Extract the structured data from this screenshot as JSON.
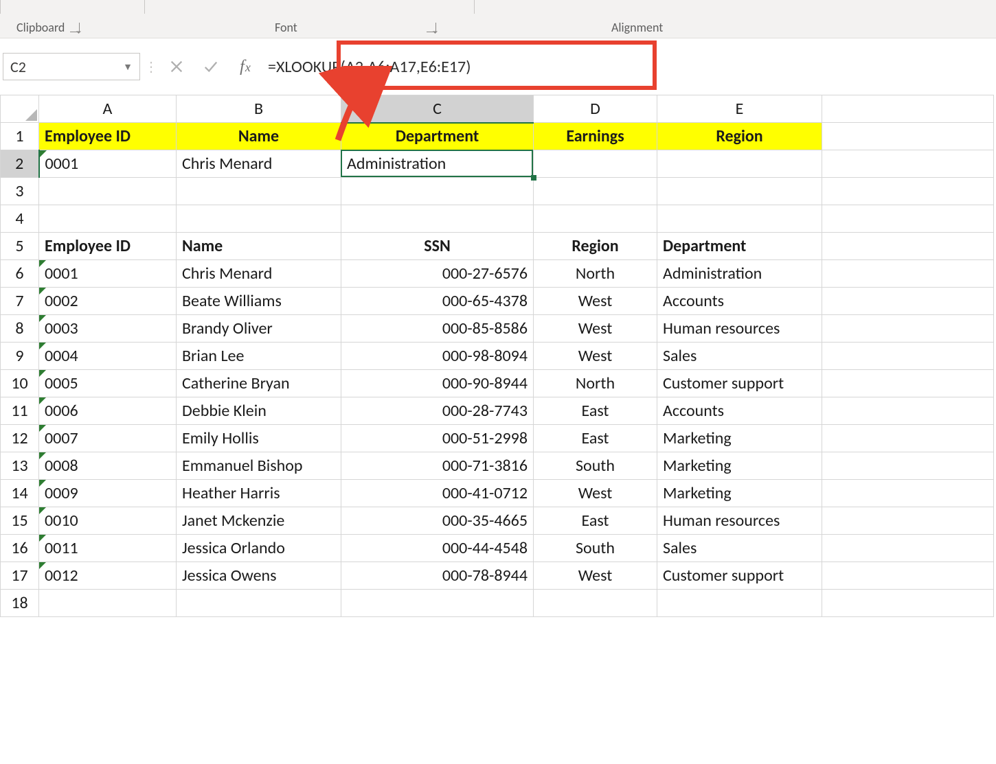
{
  "ribbon": {
    "groups": {
      "clipboard": "Clipboard",
      "font": "Font",
      "alignment": "Alignment"
    }
  },
  "namebox": {
    "value": "C2"
  },
  "formula_bar": {
    "fx_label": "fx",
    "value": "=XLOOKUP(A2,A6:A17,E6:E17)"
  },
  "columns": [
    "A",
    "B",
    "C",
    "D",
    "E"
  ],
  "selected_col": "C",
  "selected_row": 2,
  "row1": {
    "A": "Employee ID",
    "B": "Name",
    "C": "Department",
    "D": "Earnings",
    "E": "Region"
  },
  "row2": {
    "A": "0001",
    "B": "Chris Menard",
    "C": "Administration",
    "D": "",
    "E": ""
  },
  "row5": {
    "A": "Employee ID",
    "B": "Name",
    "C": "SSN",
    "D": "Region",
    "E": "Department"
  },
  "data_rows": [
    {
      "r": 6,
      "A": "0001",
      "B": "Chris Menard",
      "C": "000-27-6576",
      "D": "North",
      "E": "Administration"
    },
    {
      "r": 7,
      "A": "0002",
      "B": "Beate Williams",
      "C": "000-65-4378",
      "D": "West",
      "E": "Accounts"
    },
    {
      "r": 8,
      "A": "0003",
      "B": "Brandy Oliver",
      "C": "000-85-8586",
      "D": "West",
      "E": "Human resources"
    },
    {
      "r": 9,
      "A": "0004",
      "B": "Brian Lee",
      "C": "000-98-8094",
      "D": "West",
      "E": "Sales"
    },
    {
      "r": 10,
      "A": "0005",
      "B": "Catherine Bryan",
      "C": "000-90-8944",
      "D": "North",
      "E": "Customer support"
    },
    {
      "r": 11,
      "A": "0006",
      "B": "Debbie Klein",
      "C": "000-28-7743",
      "D": "East",
      "E": "Accounts"
    },
    {
      "r": 12,
      "A": "0007",
      "B": "Emily Hollis",
      "C": "000-51-2998",
      "D": "East",
      "E": "Marketing"
    },
    {
      "r": 13,
      "A": "0008",
      "B": "Emmanuel Bishop",
      "C": "000-71-3816",
      "D": "South",
      "E": "Marketing"
    },
    {
      "r": 14,
      "A": "0009",
      "B": "Heather Harris",
      "C": "000-41-0712",
      "D": "West",
      "E": "Marketing"
    },
    {
      "r": 15,
      "A": "0010",
      "B": "Janet Mckenzie",
      "C": "000-35-4665",
      "D": "East",
      "E": "Human resources"
    },
    {
      "r": 16,
      "A": "0011",
      "B": "Jessica Orlando",
      "C": "000-44-4548",
      "D": "South",
      "E": "Sales"
    },
    {
      "r": 17,
      "A": "0012",
      "B": "Jessica Owens",
      "C": "000-78-8944",
      "D": "West",
      "E": "Customer support"
    }
  ],
  "blank_rows_after": [
    3,
    4,
    18
  ]
}
